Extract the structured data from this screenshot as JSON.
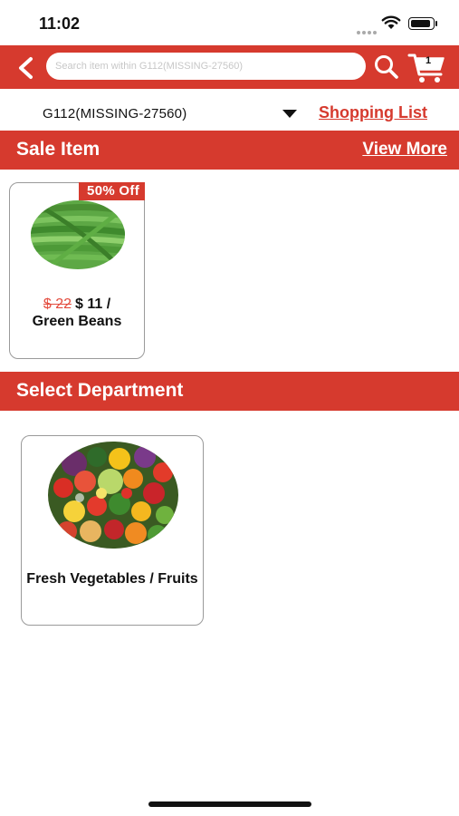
{
  "status_bar": {
    "time": "11:02"
  },
  "header": {
    "search_placeholder": "Search item within G112(MISSING-27560)",
    "cart_count": "1",
    "accent_color": "#d63a2e"
  },
  "store": {
    "name": "G112(MISSING-27560)",
    "shopping_list_label": "Shopping List"
  },
  "sale_section": {
    "title": "Sale Item",
    "view_more_label": "View More",
    "items": [
      {
        "discount": "50% Off",
        "old_price": "$ 22",
        "new_price": "$ 11 /",
        "name": "Green Beans",
        "image": "green-beans-photo"
      }
    ]
  },
  "department_section": {
    "title": "Select Department",
    "items": [
      {
        "name": "Fresh Vegetables / Fruits",
        "image": "vegetables-fruits-photo"
      }
    ]
  },
  "icons": [
    "back-chevron-icon",
    "search-icon",
    "cart-icon",
    "wifi-icon",
    "battery-icon",
    "dropdown-caret-icon"
  ]
}
